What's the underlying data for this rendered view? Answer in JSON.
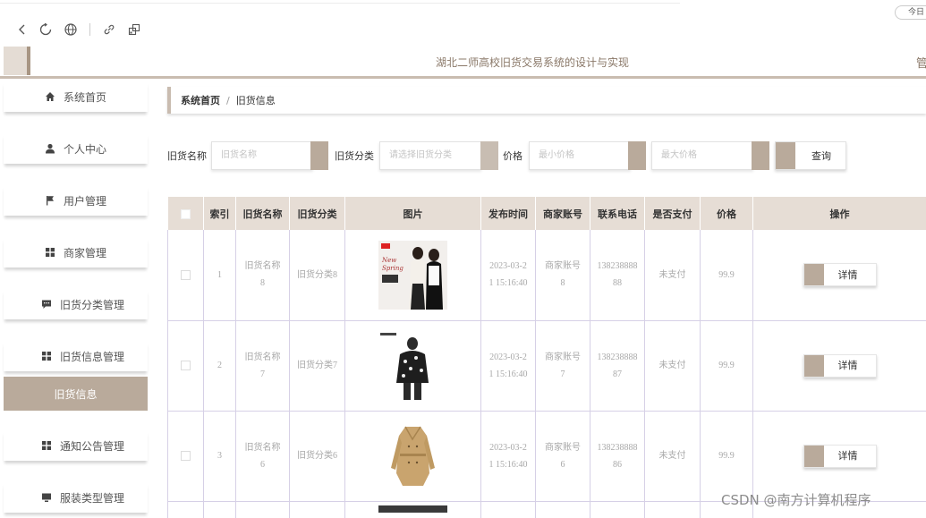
{
  "browser": {
    "today_label": "今日",
    "icons": [
      "back-icon",
      "refresh-icon",
      "globe-icon",
      "link-icon",
      "share-icon"
    ]
  },
  "header": {
    "title": "湖北二师高校旧货交易系统的设计与实现",
    "right_text": "管"
  },
  "sidebar": {
    "items": [
      {
        "label": "系统首页",
        "icon": "home-icon"
      },
      {
        "label": "个人中心",
        "icon": "user-icon"
      },
      {
        "label": "用户管理",
        "icon": "flag-icon"
      },
      {
        "label": "商家管理",
        "icon": "grid-icon"
      },
      {
        "label": "旧货分类管理",
        "icon": "comment-icon"
      },
      {
        "label": "旧货信息管理",
        "icon": "grid-icon"
      },
      {
        "label": "旧货信息",
        "icon": ""
      },
      {
        "label": "通知公告管理",
        "icon": "grid-icon"
      },
      {
        "label": "服装类型管理",
        "icon": "monitor-icon"
      }
    ],
    "active_color": "#b9aa9b"
  },
  "breadcrumb": {
    "home": "系统首页",
    "separator": "/",
    "current": "旧货信息"
  },
  "search": {
    "name_label": "旧货名称",
    "name_placeholder": "旧货名称",
    "category_label": "旧货分类",
    "category_placeholder": "请选择旧货分类",
    "price_label": "价格",
    "min_price_placeholder": "最小价格",
    "max_price_placeholder": "最大价格",
    "query_button": "查询"
  },
  "table": {
    "headers": [
      "",
      "索引",
      "旧货名称",
      "旧货分类",
      "图片",
      "发布时间",
      "商家账号",
      "联系电话",
      "是否支付",
      "价格",
      "操作"
    ],
    "rows": [
      {
        "index": "1",
        "name": "旧货名称8",
        "category": "旧货分类8",
        "image": "fashion-couple-photo",
        "time": "2023-03-21 15:16:40",
        "merchant": "商家账号8",
        "phone": "13823888888",
        "paid": "未支付",
        "price": "99.9",
        "action": "详情"
      },
      {
        "index": "2",
        "name": "旧货名称7",
        "category": "旧货分类7",
        "image": "patterned-jacket-photo",
        "time": "2023-03-21 15:16:40",
        "merchant": "商家账号7",
        "phone": "13823888887",
        "paid": "未支付",
        "price": "99.9",
        "action": "详情"
      },
      {
        "index": "3",
        "name": "旧货名称6",
        "category": "旧货分类6",
        "image": "trench-coat-photo",
        "time": "2023-03-21 15:16:40",
        "merchant": "商家账号6",
        "phone": "13823888886",
        "paid": "未支付",
        "price": "99.9",
        "action": "详情"
      }
    ]
  },
  "watermark": "CSDN @南方计算机程序",
  "colors": {
    "accent": "#b9aa9b",
    "header_bg": "#e6ddd5",
    "title": "#8a7868"
  }
}
